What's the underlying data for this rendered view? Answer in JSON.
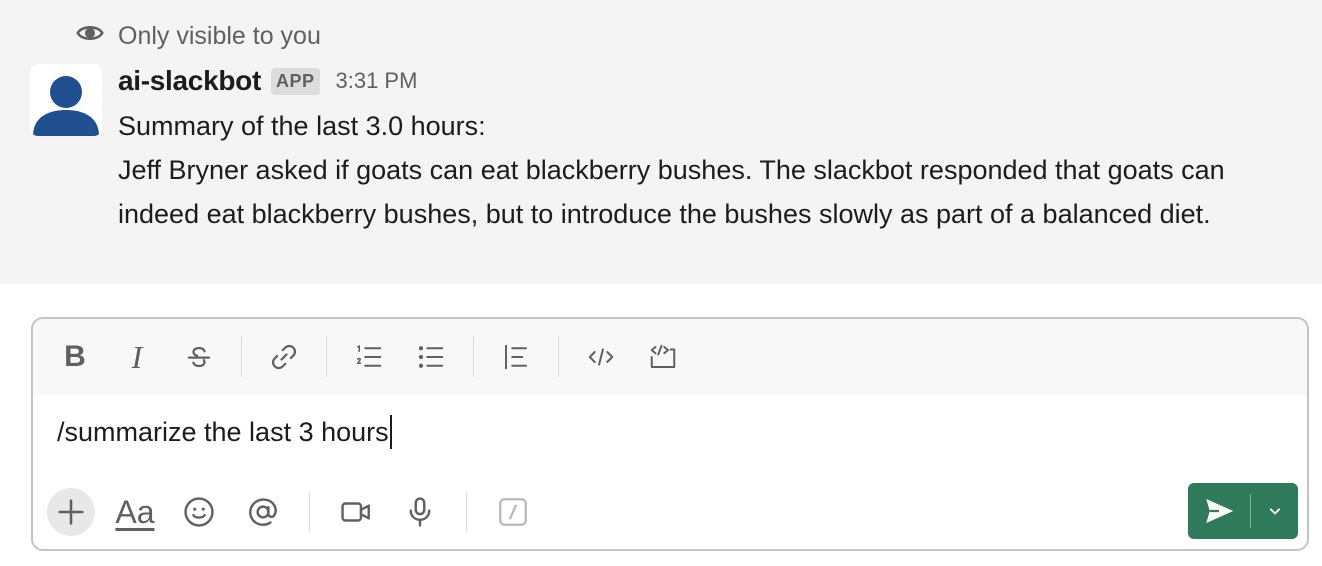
{
  "ephemeral_notice": "Only visible to you",
  "message": {
    "sender": "ai-slackbot",
    "badge": "APP",
    "time": "3:31 PM",
    "lines": [
      "Summary of the last 3.0 hours:",
      "Jeff Bryner asked if goats can eat blackberry bushes. The slackbot responded that goats can indeed eat blackberry bushes, but to introduce the bushes slowly as part of a balanced diet."
    ]
  },
  "composer": {
    "toolbar": {
      "bold_label": "B",
      "italic_label": "I",
      "icons": [
        "strikethrough-icon",
        "link-icon",
        "ordered-list-icon",
        "bulleted-list-icon",
        "blockquote-icon",
        "code-icon",
        "code-block-icon"
      ]
    },
    "input_value": "/summarize the last 3 hours",
    "bottom": {
      "format_label": "Aa",
      "icons": [
        "plus-icon",
        "emoji-icon",
        "mention-icon",
        "video-icon",
        "microphone-icon",
        "slash-shortcut-icon",
        "send-icon",
        "chevron-down-icon"
      ]
    }
  },
  "colors": {
    "send_button": "#2e7a5a",
    "message_background": "#f4f4f4",
    "avatar_blue": "#1f4f8f"
  }
}
